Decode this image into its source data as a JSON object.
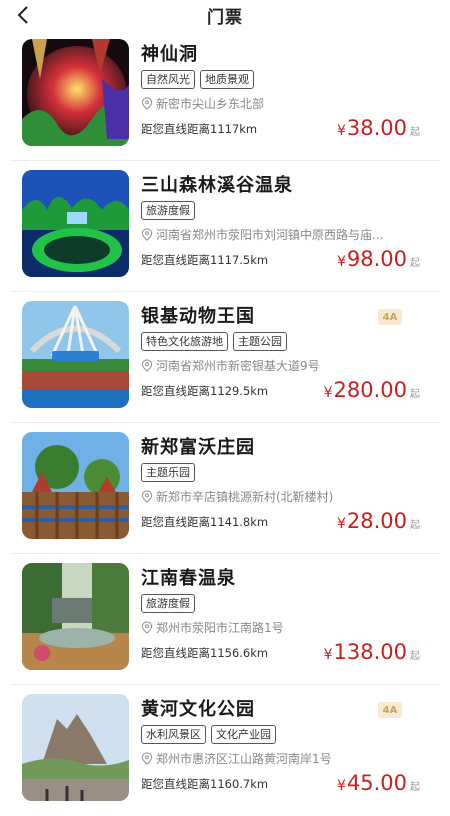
{
  "header": {
    "title": "门票"
  },
  "items": [
    {
      "name": "神仙洞",
      "level": "",
      "tags": [
        "自然风光",
        "地质景观"
      ],
      "address": "新密市尖山乡东北部",
      "distance": "距您直线距离1117km",
      "currency": "¥",
      "price": "38.00",
      "price_suffix": "起"
    },
    {
      "name": "三山森林溪谷温泉",
      "level": "",
      "tags": [
        "旅游度假"
      ],
      "address": "河南省郑州市荥阳市刘河镇中原西路与庙...",
      "distance": "距您直线距离1117.5km",
      "currency": "¥",
      "price": "98.00",
      "price_suffix": "起"
    },
    {
      "name": "银基动物王国",
      "level": "4A",
      "tags": [
        "特色文化旅游地",
        "主题公园"
      ],
      "address": "河南省郑州市新密银基大道9号",
      "distance": "距您直线距离1129.5km",
      "currency": "¥",
      "price": "280.00",
      "price_suffix": "起"
    },
    {
      "name": "新郑富沃庄园",
      "level": "",
      "tags": [
        "主题乐园"
      ],
      "address": "新郑市辛店镇桃源新村(北靳楼村)",
      "distance": "距您直线距离1141.8km",
      "currency": "¥",
      "price": "28.00",
      "price_suffix": "起"
    },
    {
      "name": "江南春温泉",
      "level": "",
      "tags": [
        "旅游度假"
      ],
      "address": "郑州市荥阳市江南路1号",
      "distance": "距您直线距离1156.6km",
      "currency": "¥",
      "price": "138.00",
      "price_suffix": "起"
    },
    {
      "name": "黄河文化公园",
      "level": "4A",
      "tags": [
        "水利风景区",
        "文化产业园"
      ],
      "address": "郑州市惠济区江山路黄河南岸1号",
      "distance": "距您直线距离1160.7km",
      "currency": "¥",
      "price": "45.00",
      "price_suffix": "起"
    }
  ],
  "icons": {
    "back": "chevron-left-icon",
    "location": "location-pin-icon"
  },
  "colors": {
    "price": "#c8201f",
    "level_badge_bg": "#f7ead0",
    "level_badge_text": "#c9a35b"
  }
}
